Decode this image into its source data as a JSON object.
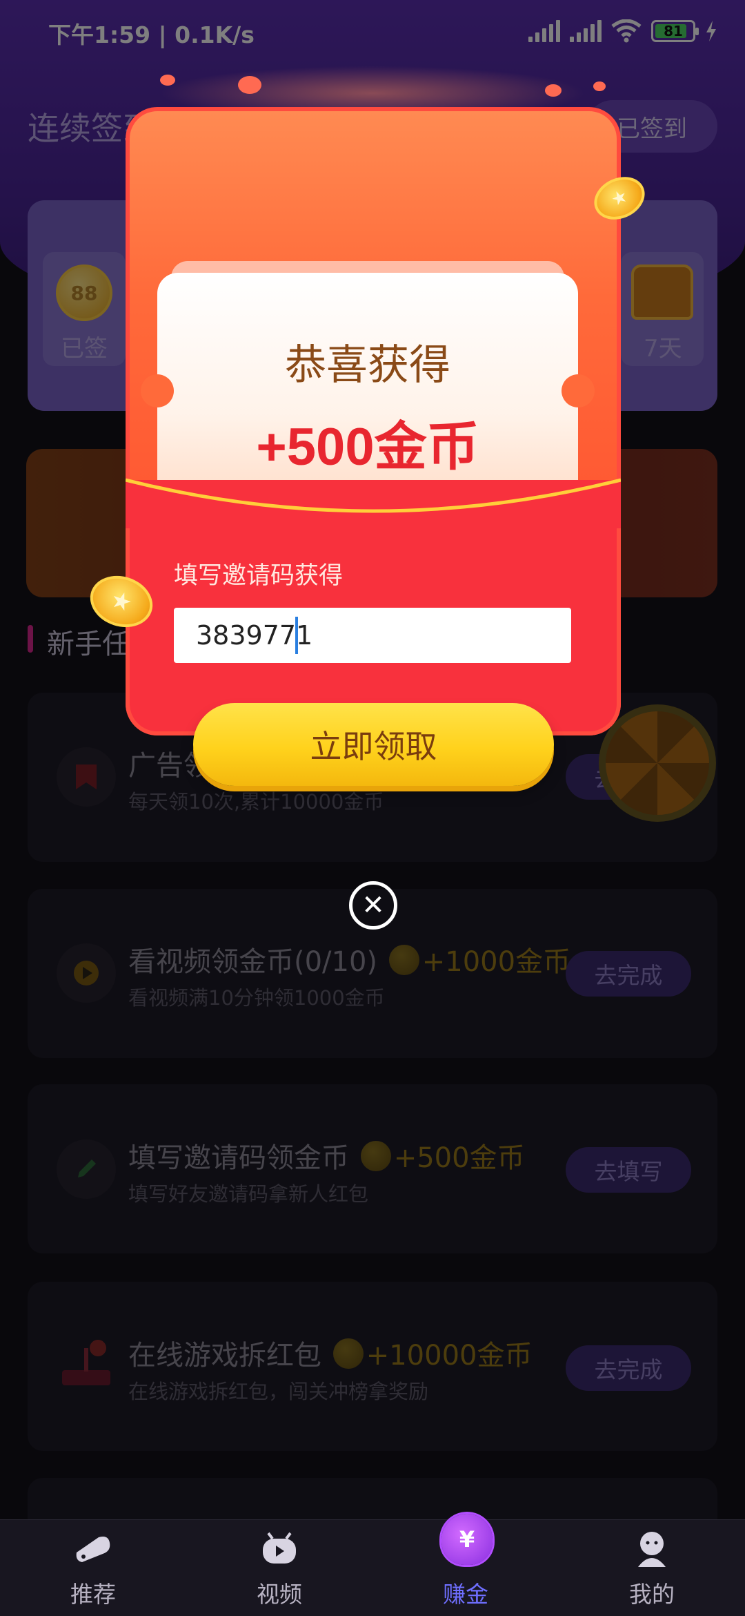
{
  "status_bar": {
    "time": "下午1:59 | 0.1K/s",
    "battery": "81"
  },
  "checkin": {
    "title": "连续签到",
    "checked_label": "已签到",
    "first_day_label": "已签",
    "first_day_coin": "88",
    "last_day_label": "7天"
  },
  "section": {
    "title": "新手任务"
  },
  "tasks": [
    {
      "title": "广告领金币",
      "reward": "",
      "subtitle": "每天领10次,累计10000金币",
      "button": "去完成",
      "icon": "bookmark-icon"
    },
    {
      "title": "看视频领金币(0/10)",
      "reward": "+1000金币",
      "subtitle": "看视频满10分钟领1000金币",
      "button": "去完成",
      "icon": "play-icon"
    },
    {
      "title": "填写邀请码领金币",
      "reward": "+500金币",
      "subtitle": "填写好友邀请码拿新人红包",
      "button": "去填写",
      "icon": "pencil-icon"
    },
    {
      "title": "在线游戏拆红包",
      "reward": "+10000金币",
      "subtitle": "在线游戏拆红包，闯关冲榜拿奖励",
      "button": "去完成",
      "icon": "joystick-icon"
    }
  ],
  "modal": {
    "congrats": "恭喜获得",
    "amount": "+500金币",
    "invite_label": "填写邀请码获得",
    "invite_value": "3839771",
    "claim_button": "立即领取"
  },
  "nav": {
    "items": [
      {
        "label": "推荐",
        "icon": "recommend-icon",
        "active": false
      },
      {
        "label": "视频",
        "icon": "video-icon",
        "active": false
      },
      {
        "label": "赚金",
        "icon": "money-bag-icon",
        "active": true
      },
      {
        "label": "我的",
        "icon": "profile-icon",
        "active": false
      }
    ]
  },
  "colors": {
    "modal_orange": "#ff6a3a",
    "modal_red": "#f8313d",
    "claim_yellow": "#ffd21c",
    "amount_red": "#e8262f",
    "nav_active": "#6f6fff"
  }
}
